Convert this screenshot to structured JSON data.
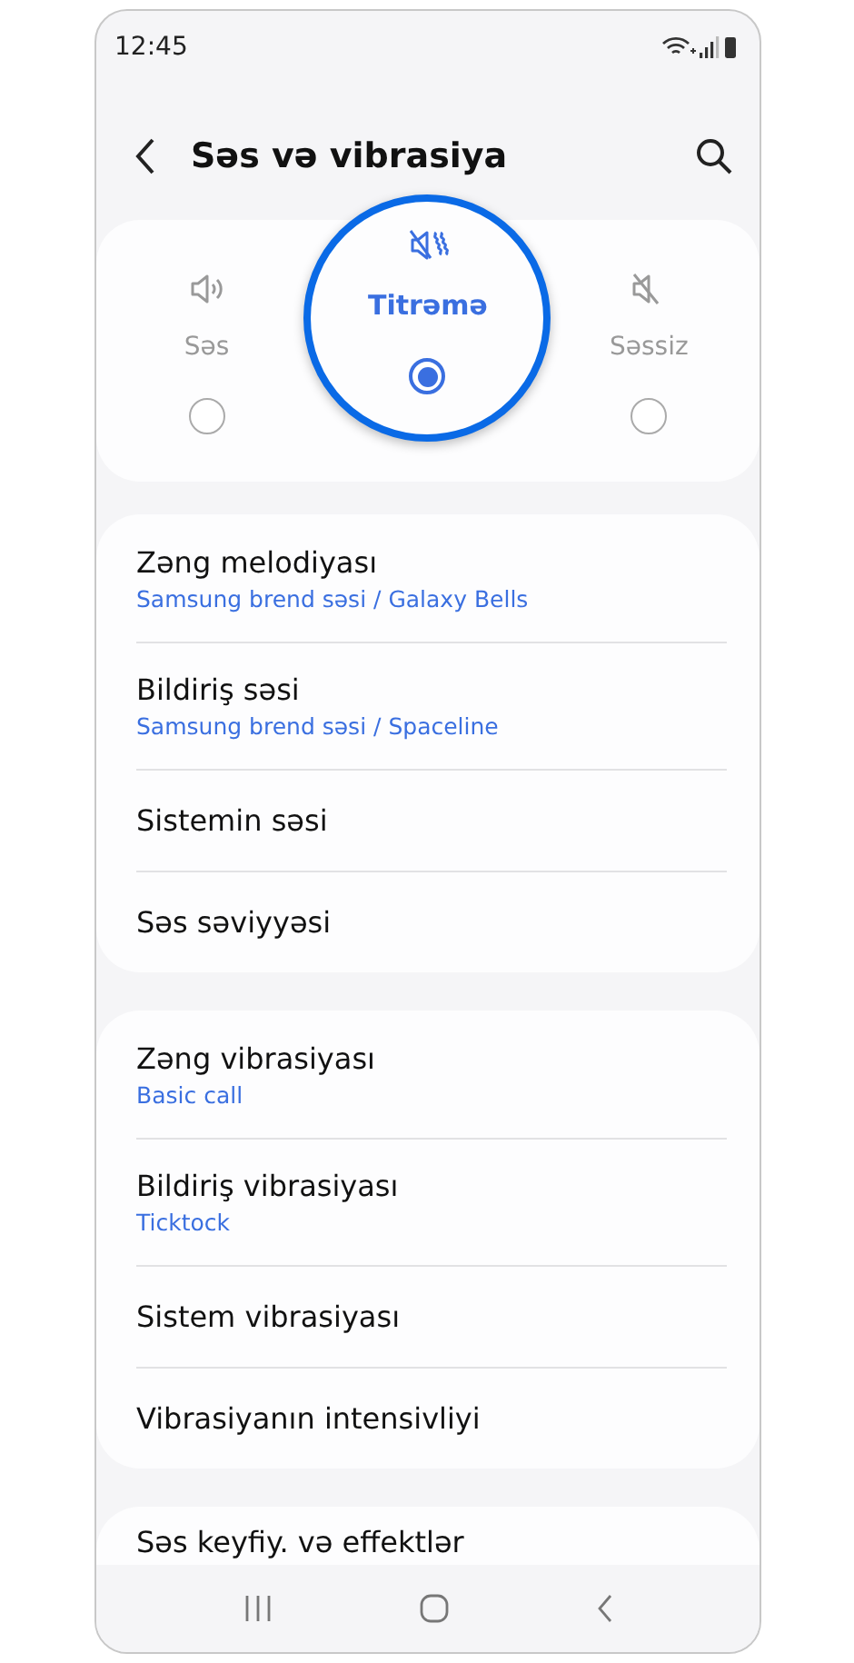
{
  "status_bar": {
    "time": "12:45"
  },
  "header": {
    "title": "Səs və vibrasiya"
  },
  "modes": [
    {
      "kind": "sound",
      "label": "Səs",
      "selected": false
    },
    {
      "kind": "vibrate",
      "label": "Titrəmə",
      "selected": true
    },
    {
      "kind": "mute",
      "label": "Səssiz",
      "selected": false
    }
  ],
  "groups": [
    {
      "items": [
        {
          "title": "Zəng melodiyası",
          "subtitle": "Samsung brend səsi / Galaxy Bells"
        },
        {
          "title": "Bildiriş səsi",
          "subtitle": "Samsung brend səsi / Spaceline"
        },
        {
          "title": "Sistemin səsi"
        },
        {
          "title": "Səs səviyyəsi"
        }
      ]
    },
    {
      "items": [
        {
          "title": "Zəng vibrasiyası",
          "subtitle": "Basic call"
        },
        {
          "title": "Bildiriş vibrasiyası",
          "subtitle": "Ticktock"
        },
        {
          "title": "Sistem vibrasiyası"
        },
        {
          "title": "Vibrasiyanın intensivliyi"
        }
      ]
    },
    {
      "items": [
        {
          "title": "Səs keyfiy. və effektlər"
        }
      ]
    }
  ]
}
